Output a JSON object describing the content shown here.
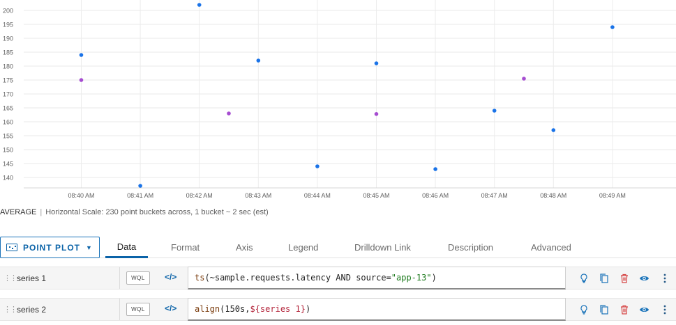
{
  "chart_data": {
    "type": "scatter",
    "y_ticks": [
      "200",
      "195",
      "190",
      "185",
      "180",
      "175",
      "170",
      "165",
      "160",
      "155",
      "150",
      "145",
      "140"
    ],
    "ylim": [
      136.5,
      202
    ],
    "x_ticks": [
      "08:40 AM",
      "08:41 AM",
      "08:42 AM",
      "08:43 AM",
      "08:44 AM",
      "08:45 AM",
      "08:46 AM",
      "08:47 AM",
      "08:48 AM",
      "08:49 AM"
    ],
    "grid": true,
    "series": [
      {
        "color": "#1a73e8",
        "points": [
          {
            "x": "08:40 AM",
            "y": 184
          },
          {
            "x": "08:41 AM",
            "y": 137
          },
          {
            "x": "08:42 AM",
            "y": 202
          },
          {
            "x": "08:43 AM",
            "y": 182
          },
          {
            "x": "08:44 AM",
            "y": 144
          },
          {
            "x": "08:45 AM",
            "y": 181
          },
          {
            "x": "08:46 AM",
            "y": 143
          },
          {
            "x": "08:47 AM",
            "y": 164
          },
          {
            "x": "08:48 AM",
            "y": 157
          },
          {
            "x": "08:49 AM",
            "y": 194
          }
        ]
      },
      {
        "color": "#a64dd1",
        "points": [
          {
            "x": "08:40 AM",
            "y": 175
          },
          {
            "x": "08:42:30 AM",
            "y": 163
          },
          {
            "x": "08:45 AM",
            "y": 162.8
          },
          {
            "x": "08:47:30 AM",
            "y": 175.5
          }
        ]
      }
    ]
  },
  "status": {
    "aggregation": "AVERAGE",
    "separator": "|",
    "scale_text": "Horizontal Scale: 230 point buckets across, 1 bucket ~ 2 sec (est)"
  },
  "plot_type": {
    "label": "POINT PLOT"
  },
  "tabs": [
    {
      "label": "Data",
      "active": true
    },
    {
      "label": "Format"
    },
    {
      "label": "Axis"
    },
    {
      "label": "Legend"
    },
    {
      "label": "Drilldown Link"
    },
    {
      "label": "Description"
    },
    {
      "label": "Advanced"
    }
  ],
  "queries": [
    {
      "name": "series 1",
      "wql_label": "WQL",
      "code_icon": "</>",
      "query_parts": [
        {
          "cls": "fn",
          "text": "ts"
        },
        {
          "cls": "plain",
          "text": "(~sample.requests.latency AND source="
        },
        {
          "cls": "str",
          "text": "\"app-13\""
        },
        {
          "cls": "plain",
          "text": ")"
        }
      ]
    },
    {
      "name": "series 2",
      "wql_label": "WQL",
      "code_icon": "</>",
      "query_parts": [
        {
          "cls": "fn",
          "text": "align"
        },
        {
          "cls": "plain",
          "text": "(150s, "
        },
        {
          "cls": "var",
          "text": "${series 1}"
        },
        {
          "cls": "plain",
          "text": ")"
        }
      ]
    }
  ],
  "row_icons": [
    "lightbulb-icon",
    "copy-icon",
    "trash-icon",
    "eye-icon",
    "more-vertical-icon"
  ],
  "colors": {
    "accent": "#0b63a8",
    "lightbulb": "#1a73b9",
    "trash": "#d64545"
  }
}
